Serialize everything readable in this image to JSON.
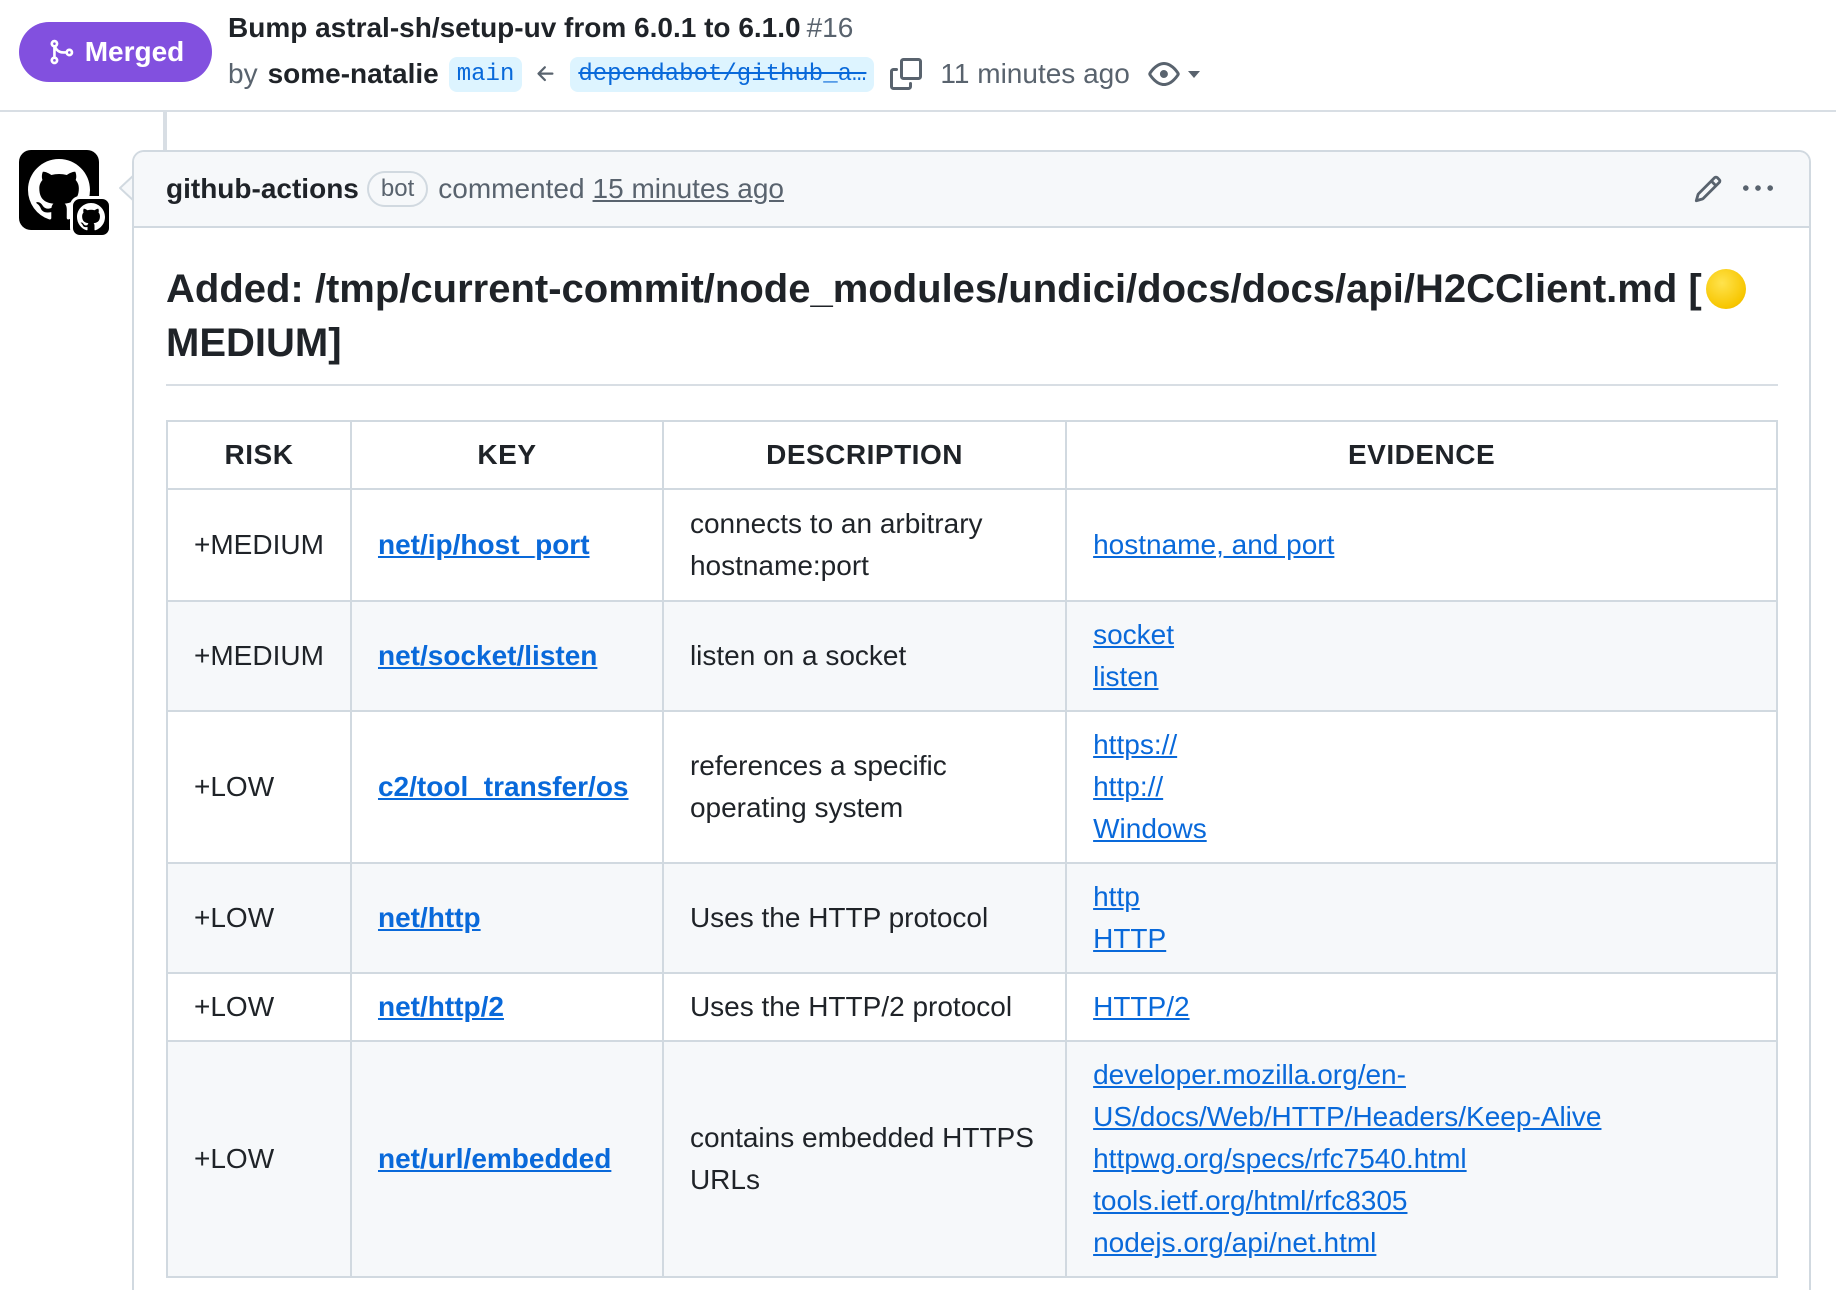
{
  "pr": {
    "status": "Merged",
    "title": "Bump astral-sh/setup-uv from 6.0.1 to 6.1.0",
    "number": "#16",
    "by": "by",
    "author": "some-natalie",
    "base_branch": "main",
    "head_branch": "dependabot/github_a…",
    "time_ago": "11 minutes ago"
  },
  "comment": {
    "author": "github-actions",
    "bot_label": "bot",
    "action": "commented",
    "time": "15 minutes ago",
    "heading_prefix": "Added: /tmp/current-commit/node_modules/undici/docs/docs/api/H2CClient.md [",
    "heading_suffix": " MEDIUM]"
  },
  "table": {
    "headers": [
      "RISK",
      "KEY",
      "DESCRIPTION",
      "EVIDENCE"
    ],
    "rows": [
      {
        "risk": "+MEDIUM",
        "key": "net/ip/host_port",
        "description": "connects to an arbitrary hostname:port",
        "evidence": [
          "hostname, and port"
        ]
      },
      {
        "risk": "+MEDIUM",
        "key": "net/socket/listen",
        "description": "listen on a socket",
        "evidence": [
          "socket",
          "listen"
        ]
      },
      {
        "risk": "+LOW",
        "key": "c2/tool_transfer/os",
        "description": "references a specific operating system",
        "evidence": [
          "https://",
          "http://",
          "Windows"
        ]
      },
      {
        "risk": "+LOW",
        "key": "net/http",
        "description": "Uses the HTTP protocol",
        "evidence": [
          "http",
          "HTTP"
        ]
      },
      {
        "risk": "+LOW",
        "key": "net/http/2",
        "description": "Uses the HTTP/2 protocol",
        "evidence": [
          "HTTP/2"
        ]
      },
      {
        "risk": "+LOW",
        "key": "net/url/embedded",
        "description": "contains embedded HTTPS URLs",
        "evidence": [
          "developer.mozilla.org/en-US/docs/Web/HTTP/Headers/Keep-Alive",
          "httpwg.org/specs/rfc7540.html",
          "tools.ietf.org/html/rfc8305",
          "nodejs.org/api/net.html"
        ]
      }
    ]
  },
  "colors": {
    "merged": "#8250df",
    "link": "#0969da",
    "branch_bg": "#ddf4ff",
    "risk_medium": "#f7c600"
  }
}
